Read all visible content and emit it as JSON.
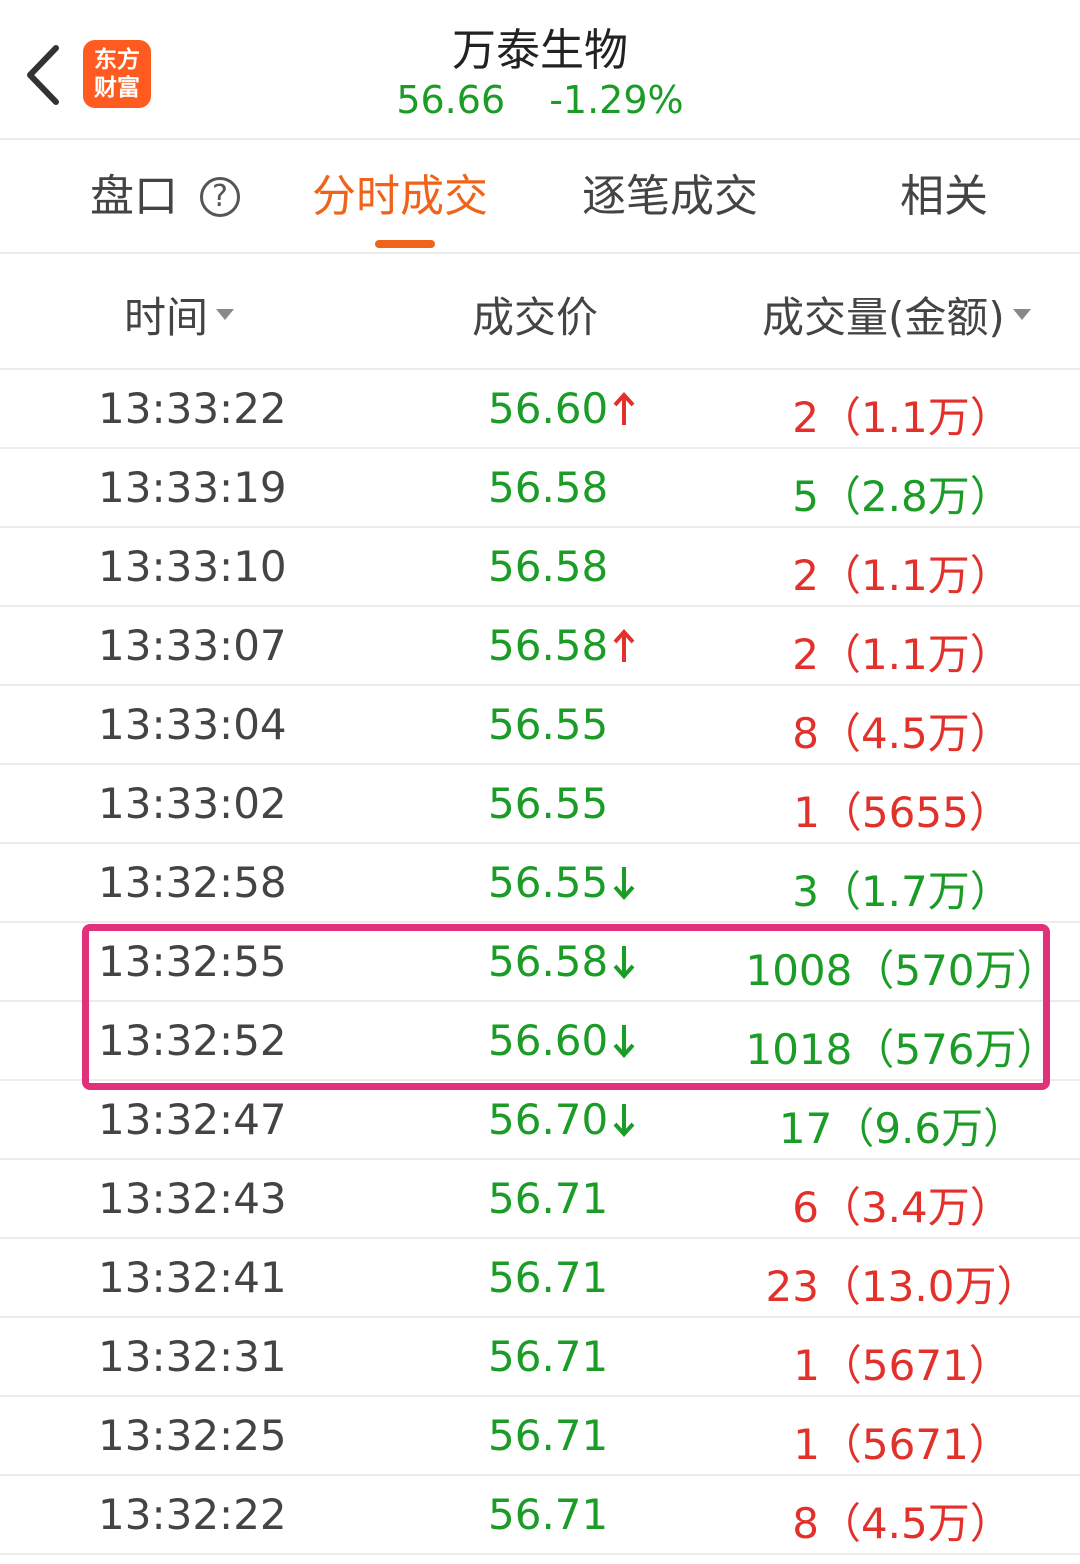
{
  "header": {
    "logo_line1": "东方",
    "logo_line2": "财富",
    "title": "万泰生物",
    "price": "56.66",
    "change": "-1.29%"
  },
  "tabs": [
    {
      "label": "盘口",
      "active": false
    },
    {
      "label": "分时成交",
      "active": true
    },
    {
      "label": "逐笔成交",
      "active": false
    },
    {
      "label": "相关",
      "active": false
    }
  ],
  "tab_help_icon": "?",
  "columns": {
    "time": "时间",
    "price": "成交价",
    "volume": "成交量(金额)"
  },
  "rows": [
    {
      "time": "13:33:22",
      "price": "56.60",
      "arrow": "up",
      "volume": "2（1.1万）",
      "vol_color": "red"
    },
    {
      "time": "13:33:19",
      "price": "56.58",
      "arrow": "",
      "volume": "5（2.8万）",
      "vol_color": "green"
    },
    {
      "time": "13:33:10",
      "price": "56.58",
      "arrow": "",
      "volume": "2（1.1万）",
      "vol_color": "red"
    },
    {
      "time": "13:33:07",
      "price": "56.58",
      "arrow": "up",
      "volume": "2（1.1万）",
      "vol_color": "red"
    },
    {
      "time": "13:33:04",
      "price": "56.55",
      "arrow": "",
      "volume": "8（4.5万）",
      "vol_color": "red"
    },
    {
      "time": "13:33:02",
      "price": "56.55",
      "arrow": "",
      "volume": "1（5655）",
      "vol_color": "red"
    },
    {
      "time": "13:32:58",
      "price": "56.55",
      "arrow": "down",
      "volume": "3（1.7万）",
      "vol_color": "green"
    },
    {
      "time": "13:32:55",
      "price": "56.58",
      "arrow": "down",
      "volume": "1008（570万）",
      "vol_color": "green"
    },
    {
      "time": "13:32:52",
      "price": "56.60",
      "arrow": "down",
      "volume": "1018（576万）",
      "vol_color": "green"
    },
    {
      "time": "13:32:47",
      "price": "56.70",
      "arrow": "down",
      "volume": "17（9.6万）",
      "vol_color": "green"
    },
    {
      "time": "13:32:43",
      "price": "56.71",
      "arrow": "",
      "volume": "6（3.4万）",
      "vol_color": "red"
    },
    {
      "time": "13:32:41",
      "price": "56.71",
      "arrow": "",
      "volume": "23（13.0万）",
      "vol_color": "red"
    },
    {
      "time": "13:32:31",
      "price": "56.71",
      "arrow": "",
      "volume": "1（5671）",
      "vol_color": "red"
    },
    {
      "time": "13:32:25",
      "price": "56.71",
      "arrow": "",
      "volume": "1（5671）",
      "vol_color": "red"
    },
    {
      "time": "13:32:22",
      "price": "56.71",
      "arrow": "",
      "volume": "8（4.5万）",
      "vol_color": "red"
    }
  ],
  "colors": {
    "accent": "#f0641a",
    "up_red": "#e2302a",
    "down_green": "#1a9c26",
    "highlight": "#e0317a"
  }
}
